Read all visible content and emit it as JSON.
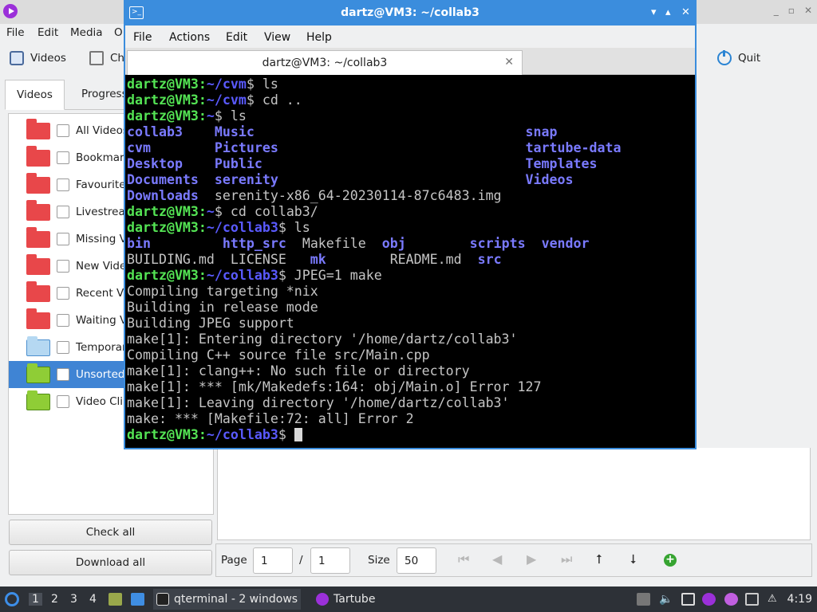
{
  "tartube": {
    "menu": [
      "File",
      "Edit",
      "Media",
      "O"
    ],
    "toolbar": {
      "videos_label": "Videos",
      "ch_label": "Ch",
      "quit_label": "Quit"
    },
    "tabs": [
      "Videos",
      "Progress"
    ],
    "folders": [
      {
        "label": "All Videos",
        "color": "red"
      },
      {
        "label": "Bookmar",
        "color": "red"
      },
      {
        "label": "Favourite",
        "color": "red"
      },
      {
        "label": "Livestrea",
        "color": "red"
      },
      {
        "label": "Missing V",
        "color": "red"
      },
      {
        "label": "New Vide",
        "color": "red"
      },
      {
        "label": "Recent Vi",
        "color": "red"
      },
      {
        "label": "Waiting V",
        "color": "red"
      },
      {
        "label": "Temporar",
        "color": "blue"
      },
      {
        "label": "Unsorted",
        "color": "green",
        "selected": true
      },
      {
        "label": "Video Clip",
        "color": "green"
      }
    ],
    "check_all_label": "Check all",
    "download_all_label": "Download all",
    "pager": {
      "page_label": "Page",
      "page_value": "1",
      "separator": "/",
      "total_pages": "1",
      "size_label": "Size",
      "size_value": "50"
    }
  },
  "terminal": {
    "title": "dartz@VM3: ~/collab3",
    "menu": [
      "File",
      "Actions",
      "Edit",
      "View",
      "Help"
    ],
    "tab_label": "dartz@VM3: ~/collab3",
    "lines": [
      [
        {
          "t": "dartz@VM3:",
          "c": "u"
        },
        {
          "t": "~/cvm",
          "c": "p"
        },
        {
          "t": "$ ls"
        }
      ],
      [
        {
          "t": "dartz@VM3:",
          "c": "u"
        },
        {
          "t": "~/cvm",
          "c": "p"
        },
        {
          "t": "$ cd .."
        }
      ],
      [
        {
          "t": "dartz@VM3:",
          "c": "u"
        },
        {
          "t": "~",
          "c": "p"
        },
        {
          "t": "$ ls"
        }
      ],
      [
        {
          "t": "collab3",
          "c": "d"
        },
        {
          "t": "    "
        },
        {
          "t": "Music",
          "c": "d"
        },
        {
          "t": "                                  "
        },
        {
          "t": "snap",
          "c": "d"
        }
      ],
      [
        {
          "t": "cvm",
          "c": "d"
        },
        {
          "t": "        "
        },
        {
          "t": "Pictures",
          "c": "d"
        },
        {
          "t": "                               "
        },
        {
          "t": "tartube-data",
          "c": "d"
        }
      ],
      [
        {
          "t": "Desktop",
          "c": "d"
        },
        {
          "t": "    "
        },
        {
          "t": "Public",
          "c": "d"
        },
        {
          "t": "                                 "
        },
        {
          "t": "Templates",
          "c": "d"
        }
      ],
      [
        {
          "t": "Documents",
          "c": "d"
        },
        {
          "t": "  "
        },
        {
          "t": "serenity",
          "c": "d"
        },
        {
          "t": "                               "
        },
        {
          "t": "Videos",
          "c": "d"
        }
      ],
      [
        {
          "t": "Downloads",
          "c": "d"
        },
        {
          "t": "  serenity-x86_64-20230114-87c6483.img"
        }
      ],
      [
        {
          "t": "dartz@VM3:",
          "c": "u"
        },
        {
          "t": "~",
          "c": "p"
        },
        {
          "t": "$ cd collab3/"
        }
      ],
      [
        {
          "t": "dartz@VM3:",
          "c": "u"
        },
        {
          "t": "~/collab3",
          "c": "p"
        },
        {
          "t": "$ ls"
        }
      ],
      [
        {
          "t": "bin",
          "c": "d"
        },
        {
          "t": "         "
        },
        {
          "t": "http_src",
          "c": "d"
        },
        {
          "t": "  Makefile  "
        },
        {
          "t": "obj",
          "c": "d"
        },
        {
          "t": "        "
        },
        {
          "t": "scripts",
          "c": "d"
        },
        {
          "t": "  "
        },
        {
          "t": "vendor",
          "c": "d"
        }
      ],
      [
        {
          "t": "BUILDING.md  LICENSE   "
        },
        {
          "t": "mk",
          "c": "d"
        },
        {
          "t": "        README.md  "
        },
        {
          "t": "src",
          "c": "d"
        }
      ],
      [
        {
          "t": "dartz@VM3:",
          "c": "u"
        },
        {
          "t": "~/collab3",
          "c": "p"
        },
        {
          "t": "$ JPEG=1 make"
        }
      ],
      [
        {
          "t": "Compiling targeting *nix"
        }
      ],
      [
        {
          "t": "Building in release mode"
        }
      ],
      [
        {
          "t": "Building JPEG support"
        }
      ],
      [
        {
          "t": "make[1]: Entering directory '/home/dartz/collab3'"
        }
      ],
      [
        {
          "t": "Compiling C++ source file src/Main.cpp"
        }
      ],
      [
        {
          "t": "make[1]: clang++: No such file or directory"
        }
      ],
      [
        {
          "t": "make[1]: *** [mk/Makedefs:164: obj/Main.o] Error 127"
        }
      ],
      [
        {
          "t": "make[1]: Leaving directory '/home/dartz/collab3'"
        }
      ],
      [
        {
          "t": "make: *** [Makefile:72: all] Error 2"
        }
      ],
      [
        {
          "t": "dartz@VM3:",
          "c": "u"
        },
        {
          "t": "~/collab3",
          "c": "p"
        },
        {
          "t": "$ "
        },
        {
          "cursor": true
        }
      ]
    ]
  },
  "taskbar": {
    "workspaces": [
      "1",
      "2",
      "3",
      "4"
    ],
    "tasks": [
      {
        "label": "qterminal - 2 windows",
        "icon": "terminal-icon"
      },
      {
        "label": "Tartube",
        "icon": "tartube-icon"
      }
    ],
    "clock": "4:19"
  },
  "colors": {
    "accent": "#3b8ddd",
    "selection": "#3f84d4",
    "prompt_user": "#54e454",
    "prompt_path": "#5a5aff",
    "terminal_bg": "#000000"
  }
}
